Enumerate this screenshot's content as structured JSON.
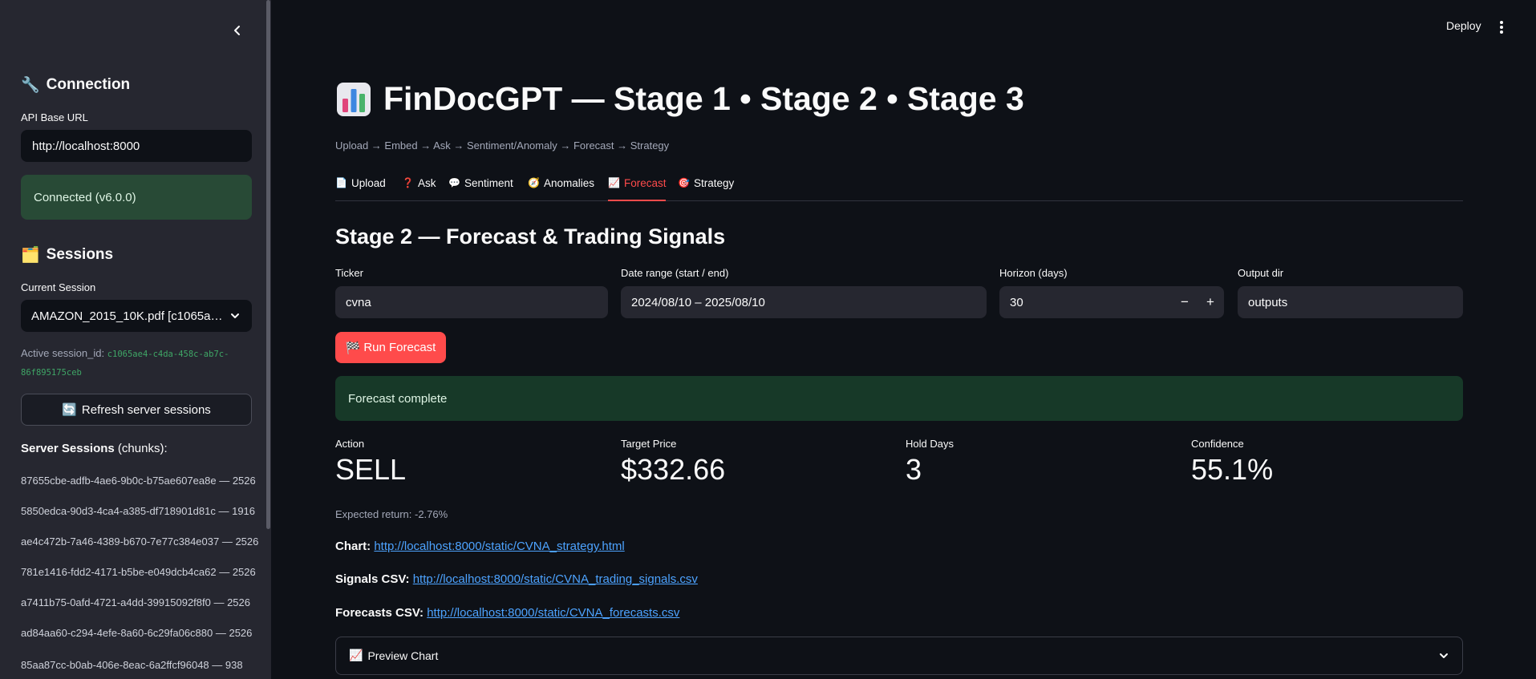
{
  "header": {
    "deploy_label": "Deploy"
  },
  "sidebar": {
    "connection_heading": "Connection",
    "api_base_url_label": "API Base URL",
    "api_base_url_value": "http://localhost:8000",
    "connected_status": "Connected (v6.0.0)",
    "sessions_heading": "Sessions",
    "current_session_label": "Current Session",
    "current_session_value": "AMAZON_2015_10K.pdf [c1065a…",
    "active_session_label": "Active session_id:",
    "active_session_id": "c1065ae4-c4da-458c-ab7c-86f895175ceb",
    "refresh_button_label": "Refresh server sessions",
    "server_sessions_title": "Server Sessions",
    "server_sessions_suffix": "(chunks):",
    "server_sessions": [
      "87655cbe-adfb-4ae6-9b0c-b75ae607ea8e — 2526",
      "5850edca-90d3-4ca4-a385-df718901d81c — 1916",
      "ae4c472b-7a46-4389-b670-7e77c384e037 — 2526",
      "781e1416-fdd2-4171-b5be-e049dcb4ca62 — 2526",
      "a7411b75-0afd-4721-a4dd-39915092f8f0 — 2526",
      "ad84aa60-c294-4efe-8a60-6c29fa06c880 — 2526",
      "85aa87cc-b0ab-406e-8eac-6a2ffcf96048 — 938"
    ]
  },
  "main": {
    "title": "FinDocGPT — Stage 1 • Stage 2 • Stage 3",
    "caption": "Upload → Embed → Ask → Sentiment/Anomaly → Forecast → Strategy",
    "tabs": [
      {
        "label": "Upload",
        "icon": "📄"
      },
      {
        "label": "Ask",
        "icon": "❓"
      },
      {
        "label": "Sentiment",
        "icon": "💬"
      },
      {
        "label": "Anomalies",
        "icon": "🧭"
      },
      {
        "label": "Forecast",
        "icon": "📈"
      },
      {
        "label": "Strategy",
        "icon": "🎯"
      }
    ],
    "active_tab": "Forecast",
    "section_title": "Stage 2 — Forecast & Trading Signals",
    "form": {
      "ticker_label": "Ticker",
      "ticker_value": "cvna",
      "date_range_label": "Date range (start / end)",
      "date_range_value": "2024/08/10 – 2025/08/10",
      "horizon_label": "Horizon (days)",
      "horizon_value": "30",
      "output_dir_label": "Output dir",
      "output_dir_value": "outputs",
      "run_button_label": "Run Forecast"
    },
    "status_message": "Forecast complete",
    "metrics": {
      "action_label": "Action",
      "action_value": "SELL",
      "target_price_label": "Target Price",
      "target_price_value": "$332.66",
      "hold_days_label": "Hold Days",
      "hold_days_value": "3",
      "confidence_label": "Confidence",
      "confidence_value": "55.1%"
    },
    "expected_return": "Expected return: -2.76%",
    "links": {
      "chart_label": "Chart:",
      "chart_url": "http://localhost:8000/static/CVNA_strategy.html",
      "signals_label": "Signals CSV:",
      "signals_url": "http://localhost:8000/static/CVNA_trading_signals.csv",
      "forecasts_label": "Forecasts CSV:",
      "forecasts_url": "http://localhost:8000/static/CVNA_forecasts.csv"
    },
    "preview_chart_label": "Preview Chart"
  },
  "colors": {
    "background": "#0e1117",
    "sidebar": "#262730",
    "accent": "#ff4b4b",
    "success_bg": "#173928",
    "link": "#4da3ff"
  }
}
